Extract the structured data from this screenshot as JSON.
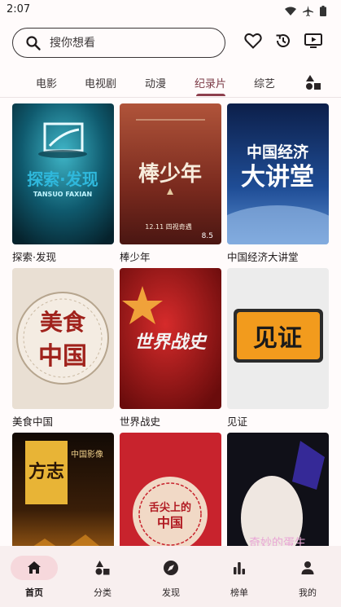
{
  "status": {
    "time": "2:07"
  },
  "search": {
    "placeholder": "搜你想看"
  },
  "tabs": [
    {
      "label": "电影"
    },
    {
      "label": "电视剧"
    },
    {
      "label": "动漫"
    },
    {
      "label": "纪录片"
    },
    {
      "label": "综艺"
    }
  ],
  "active_tab": "纪录片",
  "items": [
    {
      "title": "探索·发现",
      "poster_text_1": "探索·发现",
      "poster_text_2": "TANSUO  FAXIAN"
    },
    {
      "title": "棒少年",
      "poster_text_1": "棒少年",
      "poster_text_2": "12.11  四视奇遇",
      "poster_badge": "8.5"
    },
    {
      "title": "中国经济大讲堂",
      "poster_text_1": "中国经济",
      "poster_text_2": "大讲堂"
    },
    {
      "title": "美食中国",
      "poster_text_1": "美食",
      "poster_text_2": "中国"
    },
    {
      "title": "世界战史",
      "poster_text_1": "世界战史"
    },
    {
      "title": "见证",
      "poster_text_1": "见证"
    },
    {
      "title": "方志中国影像",
      "poster_text_1": "方志",
      "poster_text_2": "中国影像"
    },
    {
      "title": "舌尖上的中国",
      "poster_text_1": "舌尖上的",
      "poster_text_2": "中国"
    },
    {
      "title": "奇妙的蛋生",
      "poster_text_1": "奇妙的蛋生"
    }
  ],
  "nav": [
    {
      "label": "首页",
      "icon": "home-icon"
    },
    {
      "label": "分类",
      "icon": "category-icon"
    },
    {
      "label": "发现",
      "icon": "compass-icon"
    },
    {
      "label": "榜单",
      "icon": "chart-icon"
    },
    {
      "label": "我的",
      "icon": "person-icon"
    }
  ],
  "active_nav": "首页",
  "colors": {
    "accent": "#8d3f4d",
    "nav_active_bg": "#f6d8dc",
    "nav_bg": "#f8efef"
  }
}
